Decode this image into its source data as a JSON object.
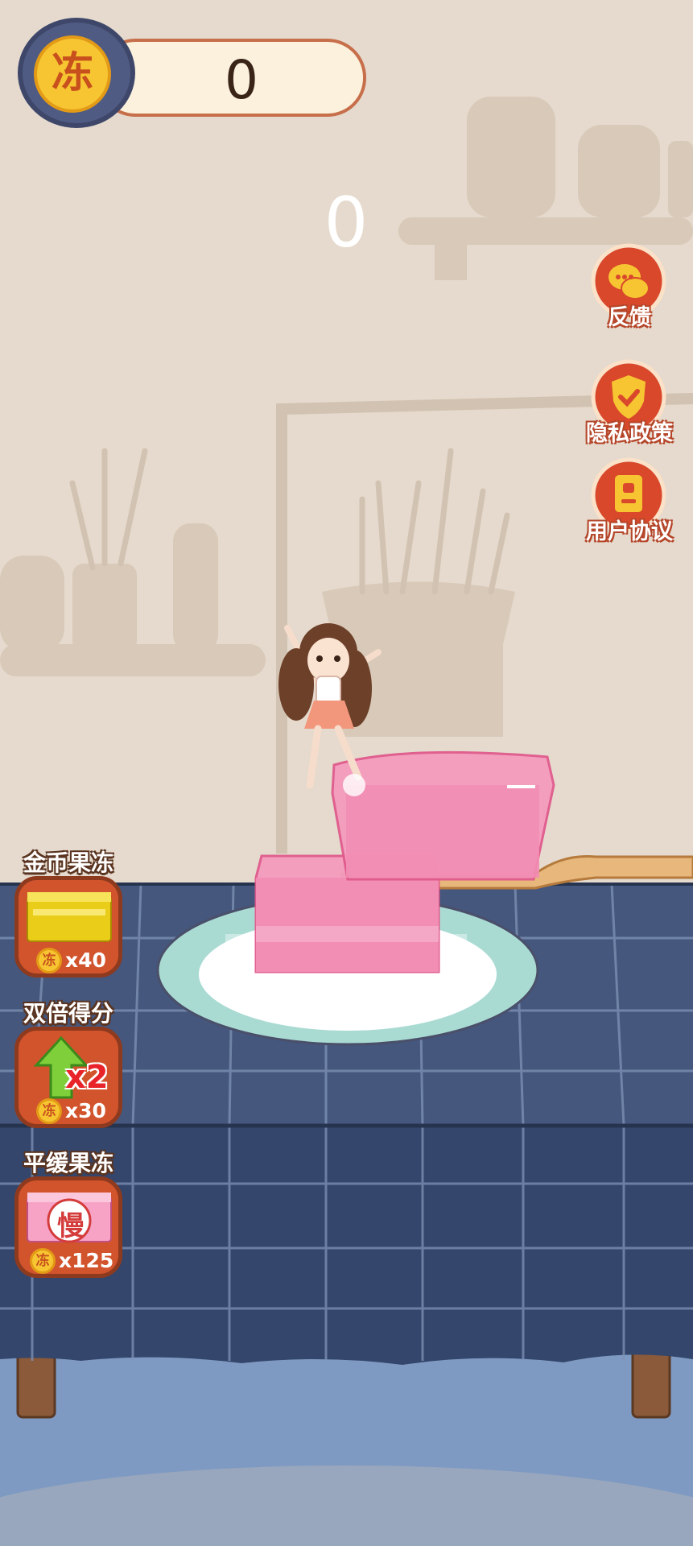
{
  "coin_bar": {
    "coin_glyph": "冻",
    "count": "0"
  },
  "score": "0",
  "side_menu": [
    {
      "label": "反馈",
      "icon": "chat-bubbles-icon"
    },
    {
      "label": "隐私政策",
      "icon": "shield-check-icon"
    },
    {
      "label": "用户协议",
      "icon": "document-icon"
    }
  ],
  "powerups": [
    {
      "title": "金币果冻",
      "cost": "x40",
      "icon": "gold-jelly-icon"
    },
    {
      "title": "双倍得分",
      "cost": "x30",
      "icon": "double-score-arrow-icon",
      "badge": "x2"
    },
    {
      "title": "平缓果冻",
      "cost": "x125",
      "icon": "slow-jelly-icon",
      "badge": "慢"
    }
  ],
  "colors": {
    "accent": "#d2542c",
    "jelly": "#f28db3",
    "tablecloth": "#3f5379",
    "floor": "#7f9ac2"
  }
}
